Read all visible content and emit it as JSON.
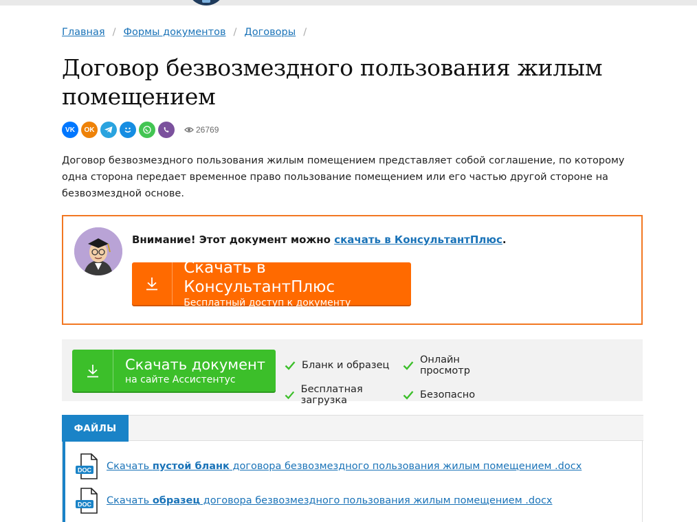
{
  "breadcrumb": {
    "items": [
      "Главная",
      "Формы документов",
      "Договоры"
    ],
    "separator": "/"
  },
  "page": {
    "title": "Договор безвозмездного пользования жилым помещением",
    "views": "26769",
    "intro": "Договор безвозмездного пользования жилым помещением представляет собой соглашение, по которому одна сторона передает временное право пользование помещением или его частью другой стороне на безвозмездной основе."
  },
  "share": {
    "buttons": [
      {
        "name": "share-vk",
        "label": "VK",
        "color": "#0077ff"
      },
      {
        "name": "share-odnoklassniki",
        "label": "OK",
        "color": "#ee8208"
      },
      {
        "name": "share-telegram",
        "label": "TG",
        "color": "#2aa3df"
      },
      {
        "name": "share-moimir",
        "label": "MM",
        "color": "#168de2"
      },
      {
        "name": "share-whatsapp",
        "label": "WA",
        "color": "#43c553"
      },
      {
        "name": "share-viber",
        "label": "VB",
        "color": "#7b519d"
      }
    ]
  },
  "consultant": {
    "notice_prefix": "Внимание! Этот документ можно ",
    "notice_link": "скачать в КонсультантПлюс",
    "notice_suffix": ".",
    "button_title": "Скачать в КонсультантПлюс",
    "button_subtitle": "Бесплатный доступ к документу",
    "border_color": "#f27721",
    "button_color": "#ff6a00"
  },
  "assistentus": {
    "button_title": "Скачать документ",
    "button_subtitle": "на сайте Ассистентус",
    "button_color": "#3cbf2a",
    "features": [
      "Бланк и образец",
      "Онлайн просмотр",
      "Бесплатная загрузка",
      "Безопасно"
    ]
  },
  "files": {
    "tab_label": "ФАЙЛЫ",
    "items": [
      {
        "prefix": "Скачать ",
        "bold": "пустой бланк",
        "suffix": " договора безвозмездного пользования жилым помещением .docx",
        "icon_label": "DOC"
      },
      {
        "prefix": "Скачать ",
        "bold": "образец",
        "suffix": " договора безвозмездного пользования жилым помещением .docx",
        "icon_label": "DOC"
      }
    ]
  }
}
